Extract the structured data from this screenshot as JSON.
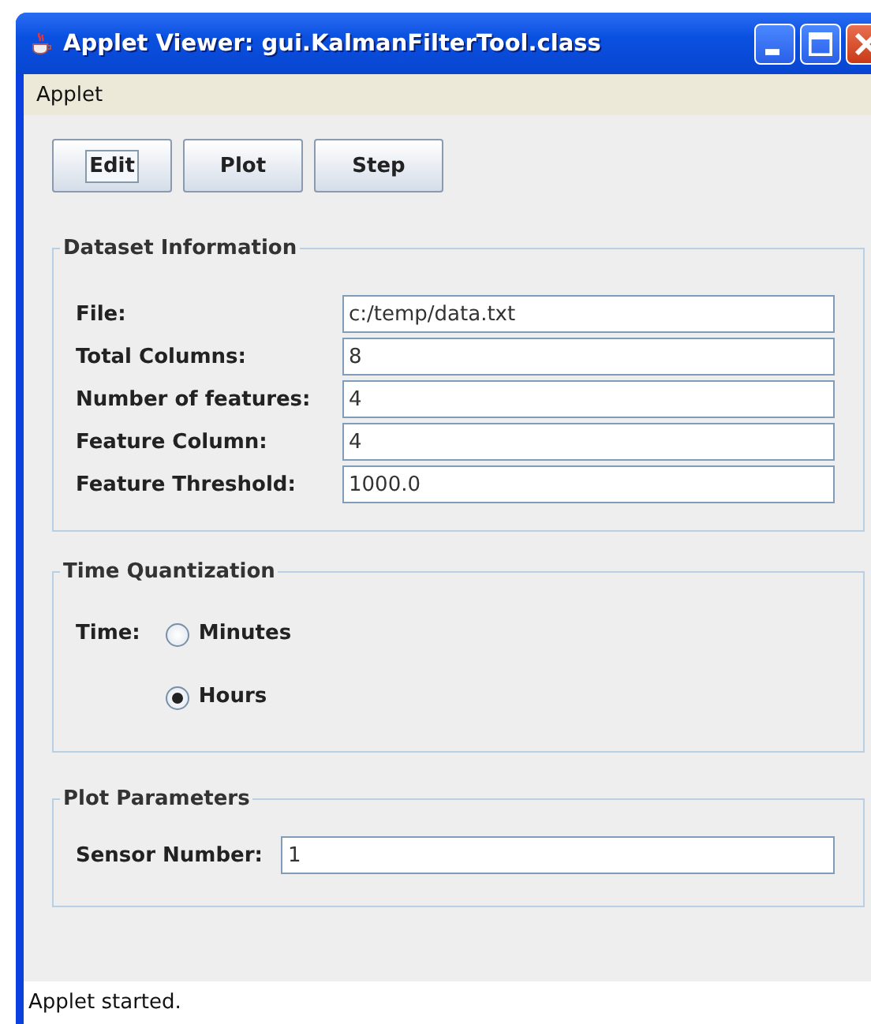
{
  "window": {
    "title": "Applet Viewer: gui.KalmanFilterTool.class"
  },
  "menu": [
    "Applet"
  ],
  "toolbar": [
    {
      "label": "Edit",
      "focused": true
    },
    {
      "label": "Plot",
      "focused": false
    },
    {
      "label": "Step",
      "focused": false
    }
  ],
  "dataset": {
    "title": "Dataset Information",
    "fields": [
      {
        "label": "File:",
        "value": "c:/temp/data.txt"
      },
      {
        "label": "Total Columns:",
        "value": "8"
      },
      {
        "label": "Number of features:",
        "value": "4"
      },
      {
        "label": "Feature Column:",
        "value": "4"
      },
      {
        "label": "Feature Threshold:",
        "value": "1000.0"
      }
    ]
  },
  "time": {
    "title": "Time Quantization",
    "label": "Time:",
    "options": [
      {
        "label": "Minutes",
        "selected": false
      },
      {
        "label": "Hours",
        "selected": true
      }
    ]
  },
  "plot": {
    "title": "Plot Parameters",
    "fields": [
      {
        "label": "Sensor Number:",
        "value": "1"
      }
    ]
  },
  "status_bar": "Applet started."
}
